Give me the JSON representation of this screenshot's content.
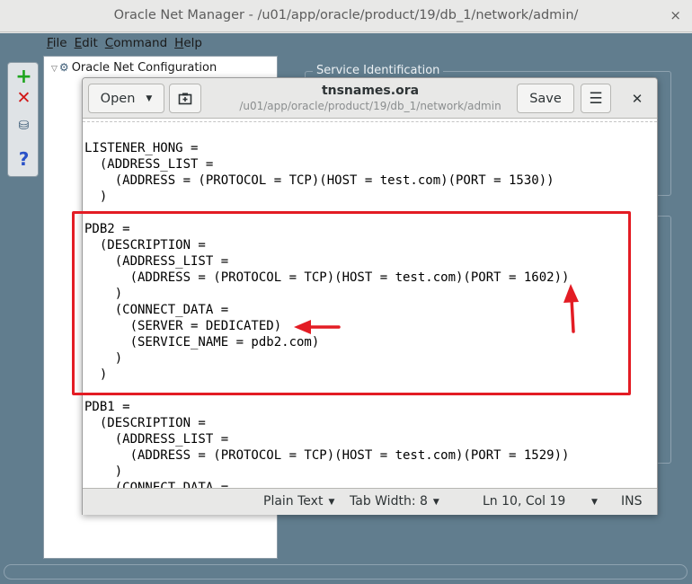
{
  "window": {
    "title": "Oracle Net Manager - /u01/app/oracle/product/19/db_1/network/admin/",
    "close_label": "×"
  },
  "menubar": [
    "File",
    "Edit",
    "Command",
    "Help"
  ],
  "toolbox": {
    "add_label": "+",
    "delete_label": "✕",
    "test_label": "⛁",
    "help_label": "?"
  },
  "tree": {
    "root_label": "Oracle Net Configuration"
  },
  "panel": {
    "section_label": "Service Identification"
  },
  "gedit": {
    "open_label": "Open",
    "title": "tnsnames.ora",
    "subtitle": "/u01/app/oracle/product/19/db_1/network/admin",
    "save_label": "Save",
    "menu_label": "☰",
    "close_label": "✕",
    "code_lines": [
      "LISTENER_HONG =",
      "  (ADDRESS_LIST =",
      "    (ADDRESS = (PROTOCOL = TCP)(HOST = test.com)(PORT = 1530))",
      "  )",
      "",
      "PDB2 =",
      "  (DESCRIPTION =",
      "    (ADDRESS_LIST =",
      "      (ADDRESS = (PROTOCOL = TCP)(HOST = test.com)(PORT = 1602))",
      "    )",
      "    (CONNECT_DATA =",
      "      (SERVER = DEDICATED)",
      "      (SERVICE_NAME = pdb2.com)",
      "    )",
      "  )",
      "",
      "PDB1 =",
      "  (DESCRIPTION =",
      "    (ADDRESS_LIST =",
      "      (ADDRESS = (PROTOCOL = TCP)(HOST = test.com)(PORT = 1529))",
      "    )",
      "    (CONNECT_DATA ="
    ],
    "status": {
      "language": "Plain Text",
      "tab_width": "Tab Width: 8",
      "position": "Ln 10, Col 19",
      "mode": "INS"
    }
  },
  "colors": {
    "background": "#617d8e",
    "annotation": "#e31c24"
  }
}
